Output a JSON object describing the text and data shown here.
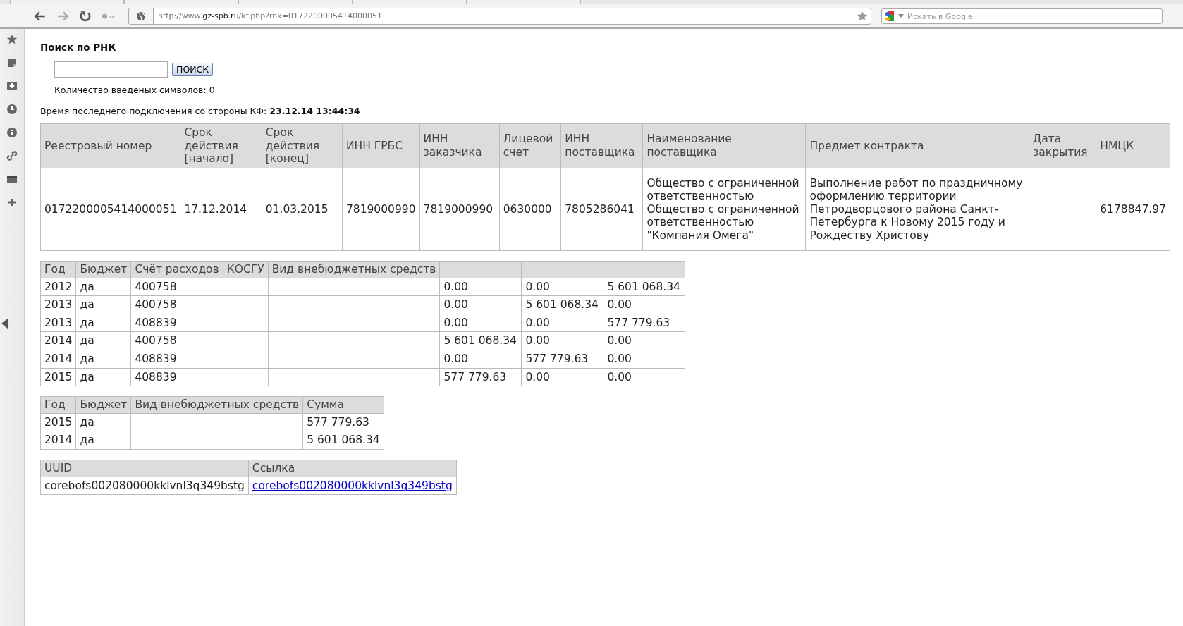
{
  "browser": {
    "url_prefix": "http://www.",
    "url_domain": "gz-spb.ru",
    "url_path": "/kf.php?rnk=0172200005414000051",
    "search_placeholder": "Искать в Google"
  },
  "search": {
    "title": "Поиск по РНК",
    "button": "ПОИСК",
    "counter": "Количество введеных символов: 0"
  },
  "last_connection": {
    "label": "Время последнего подключения со стороны КФ:",
    "value": "23.12.14 13:44:34"
  },
  "contract_table": {
    "columns": [
      "Реестровый номер",
      "Срок действия [начало]",
      "Срок действия [конец]",
      "ИНН ГРБС",
      "ИНН заказчика",
      "Лицевой счет",
      "ИНН поставщика",
      "Наименование поставщика",
      "Предмет контракта",
      "Дата закрытия",
      "НМЦК"
    ],
    "rows": [
      {
        "cells": [
          "0172200005414000051",
          "17.12.2014",
          "01.03.2015",
          "7819000990",
          "7819000990",
          "0630000",
          "7805286041",
          "Общество с ограниченной ответственностью Общество с ограниченной ответственностью \"Компания Омега\"",
          "Выполнение работ по праздничному оформлению территории Петродворцового района Санкт-Петербурга к Новому 2015 году и Рождеству Христову",
          null,
          "6178847.97"
        ]
      }
    ]
  },
  "finance_table": {
    "columns": [
      "Год",
      "Бюджет",
      "Счёт расходов",
      "КОСГУ",
      "Вид внебюджетных средств",
      null,
      null,
      null
    ],
    "rows": [
      {
        "cells": [
          "2012",
          "да",
          "400758",
          null,
          null,
          "0.00",
          "0.00",
          "5 601 068.34"
        ]
      },
      {
        "cells": [
          "2013",
          "да",
          "400758",
          null,
          null,
          "0.00",
          "5 601 068.34",
          "0.00"
        ]
      },
      {
        "cells": [
          "2013",
          "да",
          "408839",
          null,
          null,
          "0.00",
          "0.00",
          "577 779.63"
        ]
      },
      {
        "cells": [
          "2014",
          "да",
          "400758",
          null,
          null,
          "5 601 068.34",
          "0.00",
          "0.00"
        ]
      },
      {
        "cells": [
          "2014",
          "да",
          "408839",
          null,
          null,
          "0.00",
          "577 779.63",
          "0.00"
        ]
      },
      {
        "cells": [
          "2015",
          "да",
          "408839",
          null,
          null,
          "577 779.63",
          "0.00",
          "0.00"
        ]
      }
    ]
  },
  "sum_table": {
    "columns": [
      "Год",
      "Бюджет",
      "Вид внебюджетных средств",
      "Сумма"
    ],
    "rows": [
      {
        "cells": [
          "2015",
          "да",
          null,
          "577 779.63"
        ]
      },
      {
        "cells": [
          "2014",
          "да",
          null,
          "5 601 068.34"
        ]
      }
    ]
  },
  "uuid_table": {
    "columns": [
      "UUID",
      "Ссылка"
    ],
    "rows": [
      {
        "cells": [
          "corebofs002080000kklvnl3q349bstg"
        ],
        "link": "corebofs002080000kklvnl3q349bstg"
      }
    ]
  }
}
